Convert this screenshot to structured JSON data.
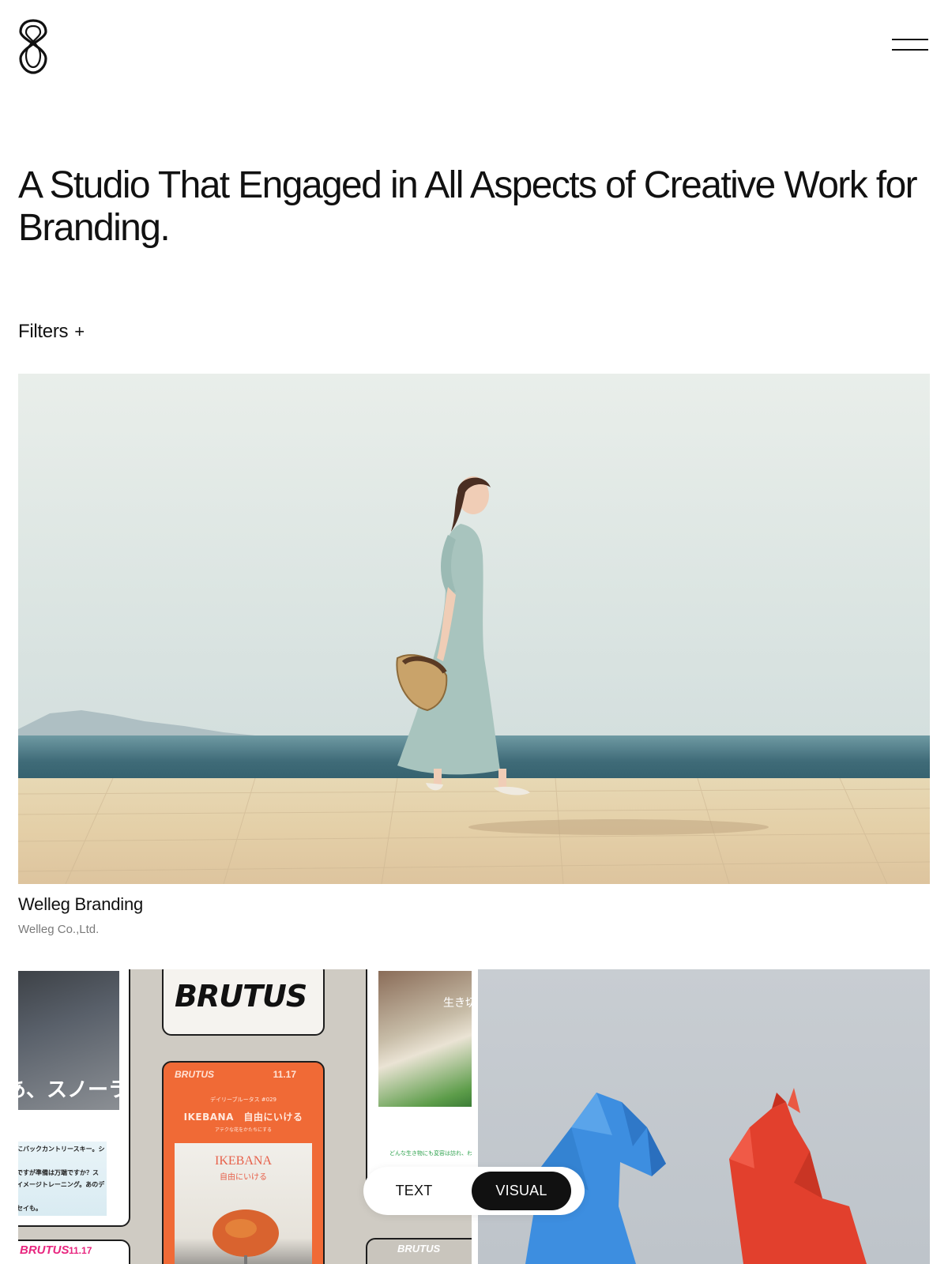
{
  "header": {
    "logo_icon": "s-loop-logo-icon",
    "menu_icon": "hamburger-menu-icon"
  },
  "headline": "A Studio That Engaged in All Aspects of Creative Work for Branding.",
  "filters": {
    "label": "Filters",
    "toggle_symbol": "+"
  },
  "projects": [
    {
      "title": "Welleg Branding",
      "client": "Welleg Co.,Ltd."
    }
  ],
  "collage": {
    "jp_title": "あ、スノーライフ",
    "body_lines": [
      "ードにバックカントリースキー。シー",
      "自由ですが準備は万端ですか？ス",
      "「サイメージトレーニング。あのデザ",
      "エッセイも。"
    ],
    "brand": "BRUTUS",
    "date": "11.17",
    "series": "デイリーブルータス #029",
    "feature": "IKEBANA　自由にいける",
    "feature_sub": "アテクな花をかたちにする",
    "poster_title": "IKEBANA",
    "poster_sub": "自由にいける",
    "side_jp": "生き切",
    "green_caption": "どんな生き物にも変容は訪れ、わか一"
  },
  "view_toggle": {
    "text_label": "TEXT",
    "visual_label": "VISUAL",
    "active": "VISUAL"
  },
  "colors": {
    "background": "#ffffff",
    "text": "#111111",
    "muted": "#7a7a7a",
    "toggle_active_bg": "#111111",
    "brutus_orange": "#f06a36",
    "brutus_pink": "#e8267f",
    "figure_blue": "#3d8ee0",
    "figure_red": "#e2402d"
  }
}
